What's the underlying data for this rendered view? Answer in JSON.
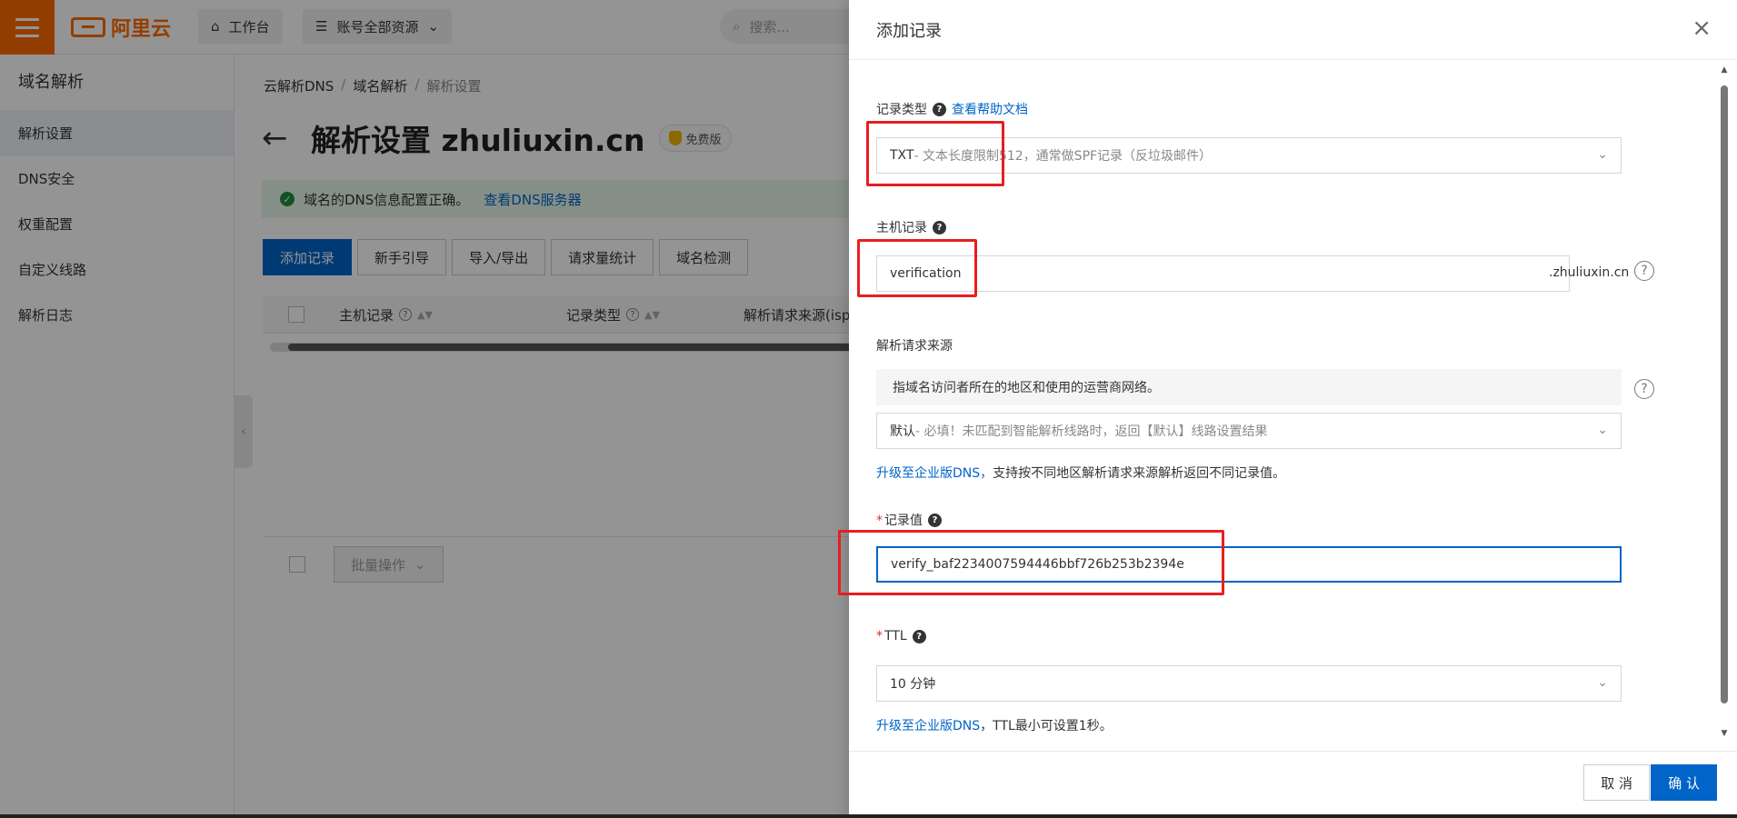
{
  "topbar": {
    "brand": "阿里云",
    "workbench": "工作台",
    "resources": "账号全部资源",
    "search_placeholder": "搜索..."
  },
  "sidebar": {
    "title": "域名解析",
    "items": [
      {
        "label": "解析设置"
      },
      {
        "label": "DNS安全"
      },
      {
        "label": "权重配置"
      },
      {
        "label": "自定义线路"
      },
      {
        "label": "解析日志"
      }
    ]
  },
  "main": {
    "breadcrumb": [
      "云解析DNS",
      "域名解析",
      "解析设置"
    ],
    "title": "解析设置 zhuliuxin.cn",
    "badge": "免费版",
    "banner_text": "域名的DNS信息配置正确。",
    "banner_link": "查看DNS服务器",
    "buttons": [
      "添加记录",
      "新手引导",
      "导入/导出",
      "请求量统计",
      "域名检测"
    ],
    "columns": [
      "主机记录",
      "记录类型",
      "解析请求来源(isp)"
    ],
    "batch_label": "批量操作"
  },
  "drawer": {
    "title": "添加记录",
    "record_type": {
      "label": "记录类型",
      "help_link": "查看帮助文档",
      "value_main": "TXT",
      "value_desc": "- 文本长度限制512，通常做SPF记录（反垃圾邮件）"
    },
    "host": {
      "label": "主机记录",
      "value": "verification",
      "suffix": ".zhuliuxin.cn"
    },
    "source": {
      "label": "解析请求来源",
      "note": "指域名访问者所在的地区和使用的运营商网络。",
      "value_main": "默认",
      "value_desc": " - 必填！未匹配到智能解析线路时，返回【默认】线路设置结果",
      "upgrade_link": "升级至企业版DNS，",
      "upgrade_text": "支持按不同地区解析请求来源解析返回不同记录值。"
    },
    "record_value": {
      "label": "记录值",
      "value": "verify_baf2234007594446bbf726b253b2394e"
    },
    "ttl": {
      "label": "TTL",
      "value": "10 分钟",
      "upgrade_link": "升级至企业版DNS",
      "upgrade_text": "，TTL最小可设置1秒。"
    },
    "cancel": "取 消",
    "confirm": "确 认"
  },
  "colors": {
    "brand_orange": "#ff6a00",
    "primary_blue": "#0064c8",
    "annotation_red": "#e81e1e",
    "required_red": "#d93026"
  }
}
